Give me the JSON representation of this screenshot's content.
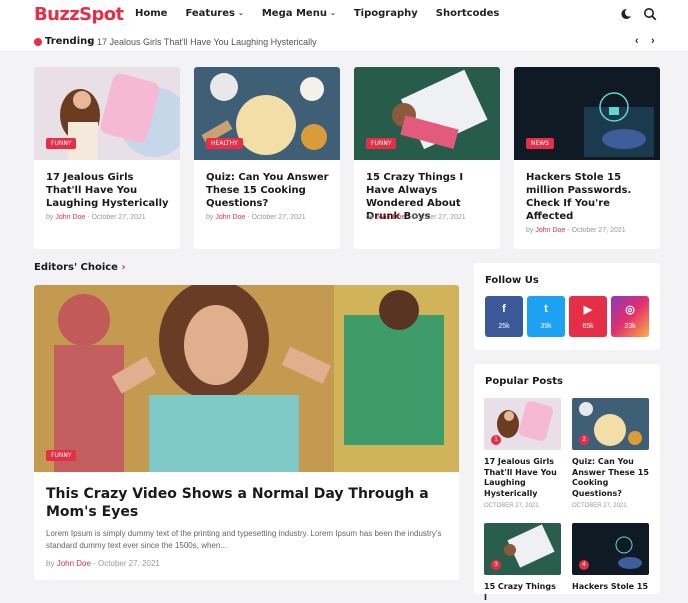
{
  "site": {
    "logo": "BuzzSpot"
  },
  "nav": [
    {
      "label": "Home",
      "dropdown": false
    },
    {
      "label": "Features",
      "dropdown": true
    },
    {
      "label": "Mega Menu",
      "dropdown": true
    },
    {
      "label": "Tipography",
      "dropdown": false
    },
    {
      "label": "Shortcodes",
      "dropdown": false
    }
  ],
  "header_icons": [
    "moon-icon",
    "search-icon"
  ],
  "trending": {
    "label": "Trending",
    "text": "17 Jealous Girls That'll Have You Laughing Hysterically"
  },
  "cards": [
    {
      "badge": "FUNNY",
      "title": "17 Jealous Girls That'll Have You Laughing Hysterically",
      "by": "by",
      "author": "John Doe",
      "date": "October 27, 2021"
    },
    {
      "badge": "HEALTHY",
      "title": "Quiz: Can You Answer These 15 Cooking Questions?",
      "by": "by",
      "author": "John Doe",
      "date": "October 27, 2021"
    },
    {
      "badge": "FUNNY",
      "title": "15 Crazy Things I Have Always Wondered About Drunk Boys",
      "by": "by",
      "author": "John Doe",
      "date": "October 27, 2021"
    },
    {
      "badge": "NEWS",
      "title": "Hackers Stole 15 million Passwords. Check If You're Affected",
      "by": "by",
      "author": "John Doe",
      "date": "October 27, 2021"
    }
  ],
  "editors_choice": {
    "heading": "Editors' Choice",
    "badge": "FUNNY",
    "title": "This Crazy Video Shows a Normal Day Through a Mom's Eyes",
    "excerpt": "Lorem Ipsum is simply dummy text of the printing and typesetting industry. Lorem Ipsum has been the industry's standard dummy text ever since the 1500s, when...",
    "by": "by",
    "author": "John Doe",
    "date": "October 27, 2021"
  },
  "follow": {
    "title": "Follow Us",
    "items": [
      {
        "icon": "facebook-icon",
        "glyph": "f",
        "count": "25k",
        "color": "#3b5998"
      },
      {
        "icon": "twitter-icon",
        "glyph": "t",
        "count": "39k",
        "color": "#1da1f2"
      },
      {
        "icon": "youtube-icon",
        "glyph": "▶",
        "count": "65k",
        "color": "#e62e47"
      },
      {
        "icon": "instagram-icon",
        "glyph": "◎",
        "count": "23k",
        "color": "#e1306c"
      }
    ]
  },
  "popular": {
    "title": "Popular Posts",
    "items": [
      {
        "num": "1",
        "title": "17 Jealous Girls That'll Have You Laughing Hysterically",
        "date": "OCTOBER 27, 2021"
      },
      {
        "num": "2",
        "title": "Quiz: Can You Answer These 15 Cooking Questions?",
        "date": "OCTOBER 27, 2021"
      },
      {
        "num": "3",
        "title": "15 Crazy Things I",
        "date": ""
      },
      {
        "num": "4",
        "title": "Hackers Stole 15",
        "date": ""
      }
    ]
  },
  "colors": {
    "accent": "#e62e47"
  }
}
